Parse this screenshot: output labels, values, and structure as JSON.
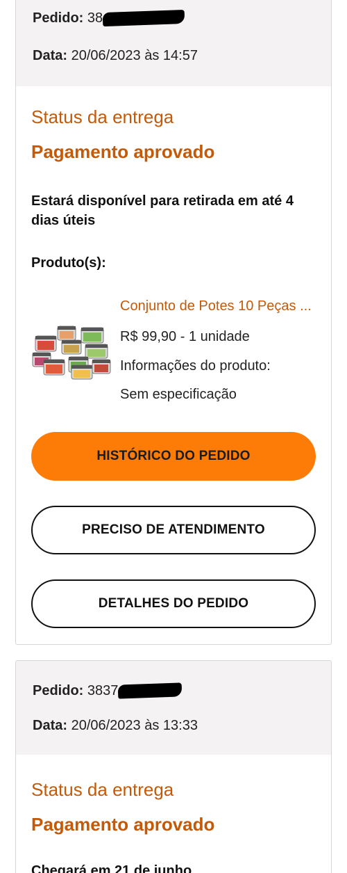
{
  "orders": [
    {
      "pedido_label": "Pedido:",
      "pedido_visible": "38",
      "data_label": "Data:",
      "data_value": "20/06/2023 às 14:57",
      "status_title": "Status da entrega",
      "status_value": "Pagamento aprovado",
      "availability": "Estará disponível para retirada em até 4 dias úteis",
      "produtos_label": "Produto(s):",
      "product": {
        "name": "Conjunto de Potes 10 Peças ...",
        "price_qty": "R$ 99,90 - 1 unidade",
        "info_label": "Informações do produto:",
        "info_value": "Sem especificação",
        "image_icon": "food-containers-image"
      },
      "buttons": {
        "historico": "HISTÓRICO DO PEDIDO",
        "atendimento": "PRECISO DE ATENDIMENTO",
        "detalhes": "DETALHES DO PEDIDO"
      }
    },
    {
      "pedido_label": "Pedido:",
      "pedido_visible": "3837",
      "data_label": "Data:",
      "data_value": "20/06/2023 às 13:33",
      "status_title": "Status da entrega",
      "status_value": "Pagamento aprovado",
      "availability": "Chegará em 21 de junho"
    }
  ],
  "colors": {
    "accent_text": "#c45a08",
    "primary_button": "#fd7c08",
    "header_bg": "#f4f2f3",
    "border": "#d6d6d6"
  }
}
